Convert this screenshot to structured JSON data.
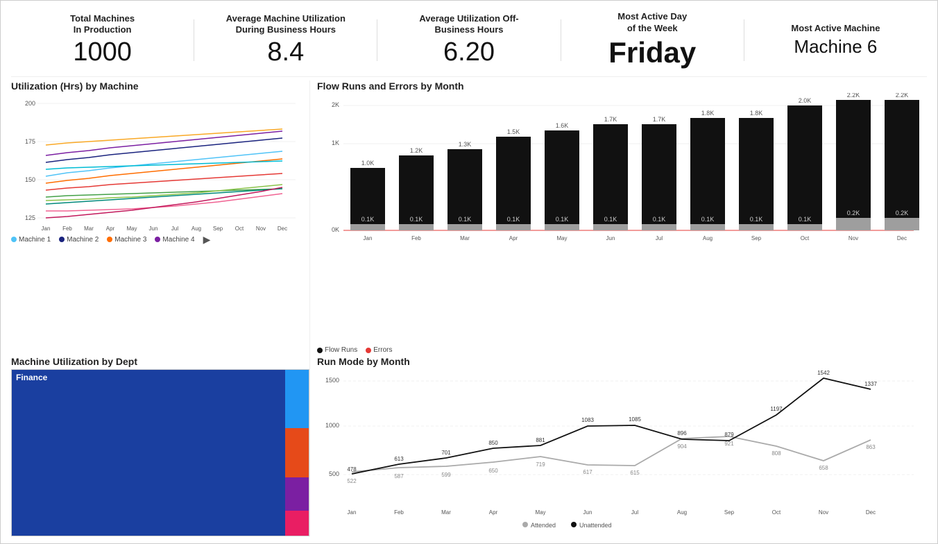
{
  "kpis": [
    {
      "id": "total-machines",
      "title": "Total Machines\nIn Production",
      "value": "1000",
      "size": "large"
    },
    {
      "id": "avg-utilization-business",
      "title": "Average Machine Utilization\nDuring Business Hours",
      "value": "8.4",
      "size": "large"
    },
    {
      "id": "avg-utilization-off",
      "title": "Average Utilization Off-\nBusiness Hours",
      "value": "6.20",
      "size": "large"
    },
    {
      "id": "most-active-day",
      "title": "Most Active Day\nof the Week",
      "value": "Friday",
      "size": "xlarge"
    },
    {
      "id": "most-active-machine",
      "title": "Most Active Machine",
      "value": "Machine 6",
      "size": "medium"
    }
  ],
  "charts": {
    "utilization_title": "Utilization (Hrs) by Machine",
    "flow_runs_title": "Flow Runs and Errors by Month",
    "machine_util_dept_title": "Machine Utilization by Dept",
    "run_mode_title": "Run Mode by Month"
  },
  "legend": {
    "machines": [
      {
        "label": "Machine 1",
        "color": "#4fc3f7"
      },
      {
        "label": "Machine 2",
        "color": "#1a237e"
      },
      {
        "label": "Machine 3",
        "color": "#ff6d00"
      },
      {
        "label": "Machine 4",
        "color": "#7b1fa2"
      }
    ],
    "flow_runs": [
      {
        "label": "Flow Runs",
        "color": "#111"
      },
      {
        "label": "Errors",
        "color": "#e53935"
      }
    ],
    "run_mode": [
      {
        "label": "Attended",
        "color": "#aaa"
      },
      {
        "label": "Unattended",
        "color": "#111"
      }
    ]
  },
  "flow_bars": [
    {
      "month": "Jan",
      "total": 1.0,
      "errors": 0.1
    },
    {
      "month": "Feb",
      "total": 1.2,
      "errors": 0.1
    },
    {
      "month": "Mar",
      "total": 1.3,
      "errors": 0.1
    },
    {
      "month": "Apr",
      "total": 1.5,
      "errors": 0.1
    },
    {
      "month": "May",
      "total": 1.6,
      "errors": 0.1
    },
    {
      "month": "Jun",
      "total": 1.7,
      "errors": 0.1
    },
    {
      "month": "Jul",
      "total": 1.7,
      "errors": 0.1
    },
    {
      "month": "Aug",
      "total": 1.8,
      "errors": 0.1
    },
    {
      "month": "Sep",
      "total": 1.8,
      "errors": 0.1
    },
    {
      "month": "Oct",
      "total": 2.0,
      "errors": 0.1
    },
    {
      "month": "Nov",
      "total": 2.2,
      "errors": 0.2
    },
    {
      "month": "Dec",
      "total": 2.2,
      "errors": 0.2
    }
  ],
  "run_mode_data": {
    "attended": [
      522,
      587,
      599,
      650,
      719,
      617,
      615,
      904,
      921,
      808,
      658,
      863
    ],
    "unattended": [
      478,
      613,
      701,
      850,
      881,
      1083,
      1085,
      896,
      879,
      1197,
      1542,
      1337
    ],
    "months": [
      "Jan",
      "Feb",
      "Mar",
      "Apr",
      "May",
      "Jun",
      "Jul",
      "Aug",
      "Sep",
      "Oct",
      "Nov",
      "Dec"
    ]
  }
}
